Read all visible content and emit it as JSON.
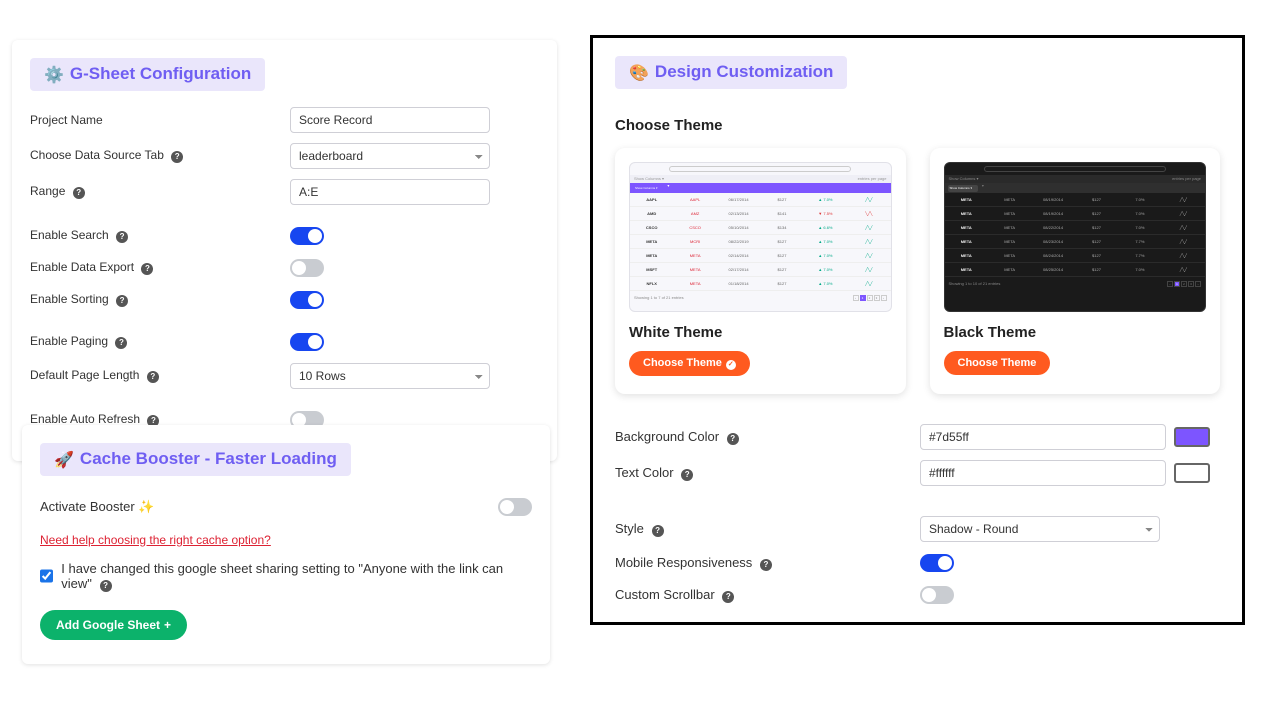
{
  "gsheet": {
    "title": "G-Sheet Configuration",
    "project_name_label": "Project Name",
    "project_name_value": "Score Record",
    "tab_label": "Choose Data Source Tab",
    "tab_value": "leaderboard",
    "range_label": "Range",
    "range_value": "A:E",
    "enable_search_label": "Enable Search",
    "enable_search": true,
    "enable_export_label": "Enable Data Export",
    "enable_export": false,
    "enable_sorting_label": "Enable Sorting",
    "enable_sorting": true,
    "enable_paging_label": "Enable Paging",
    "enable_paging": true,
    "page_length_label": "Default Page Length",
    "page_length_value": "10 Rows",
    "enable_autorefresh_label": "Enable Auto Refresh",
    "enable_autorefresh": false
  },
  "cache": {
    "title": "Cache Booster - Faster Loading",
    "activate_label": "Activate Booster ✨",
    "activate": false,
    "help_link": "Need help choosing the right cache option?",
    "confirm_label": "I have changed this google sheet sharing setting to \"Anyone with the link can view\"",
    "confirm_checked": true,
    "add_button": "Add Google Sheet"
  },
  "design": {
    "title": "Design Customization",
    "choose_theme_label": "Choose Theme",
    "white_theme_title": "White Theme",
    "black_theme_title": "Black Theme",
    "choose_button": "Choose Theme",
    "bg_label": "Background Color",
    "bg_value": "#7d55ff",
    "text_label": "Text Color",
    "text_value": "#ffffff",
    "style_label": "Style",
    "style_value": "Shadow - Round",
    "mobile_label": "Mobile Responsiveness",
    "mobile_on": true,
    "scrollbar_label": "Custom Scrollbar",
    "scrollbar_on": false
  }
}
